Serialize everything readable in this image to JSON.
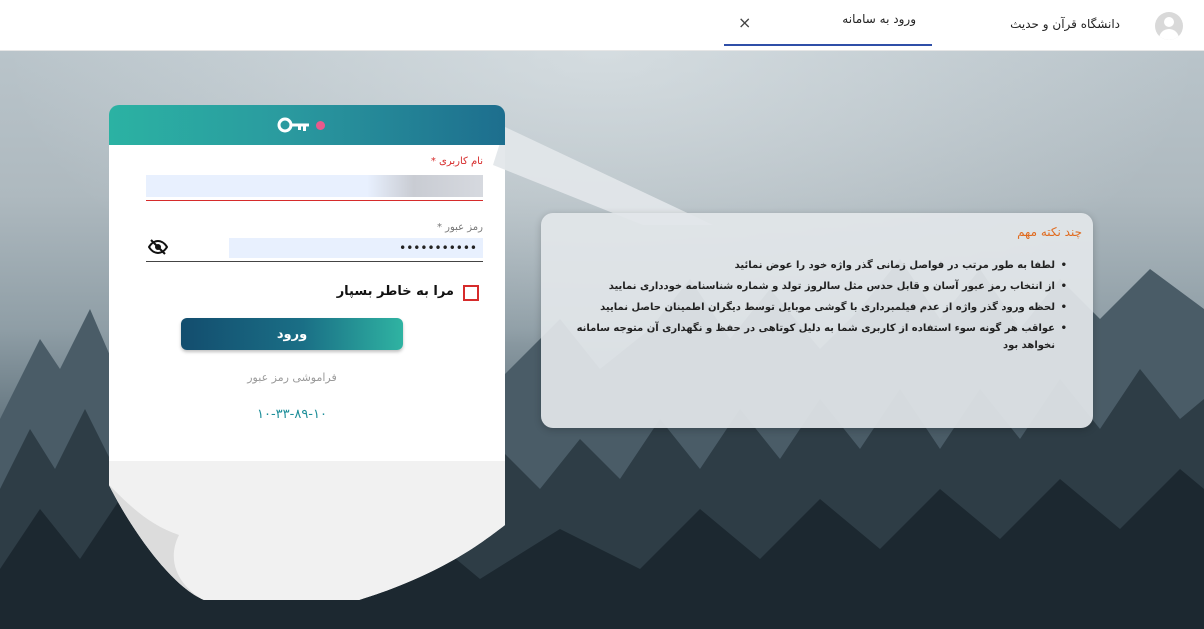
{
  "header": {
    "university_name": "دانشگاه قرآن و حدیث",
    "tab_label": "ورود به سامانه",
    "tab_close": "×"
  },
  "login": {
    "username_label": "نام کاربری *",
    "username_value": "",
    "password_label": "رمز عبور *",
    "password_value": "•••••••••••",
    "remember_label": "مرا به خاطر بسپار",
    "login_button": "ورود",
    "forgot_link": "فراموشی رمز عبور",
    "code": "۱۰-۳۳-۸۹-۱۰"
  },
  "info": {
    "title": "چند نکته مهم",
    "items": [
      "لطفا به طور مرتب در فواصل زمانی گذر واژه خود را عوض نمائید",
      "از انتخاب رمز عبور آسان و قابل حدس مثل سالروز تولد و شماره شناسنامه خودداری نمایید",
      "لحظه ورود گذر واژه از عدم فیلمبرداری با گوشی موبایل توسط دیگران اطمینان حاصل نمایید",
      "عواقب هر گونه سوء استفاده از کاربری شما به دلیل کوتاهی در حفظ و نگهداری آن متوجه سامانه نخواهد بود"
    ]
  },
  "colors": {
    "accent": "#2f4fa8",
    "header_gradient_start": "#2bb2a3",
    "header_gradient_end": "#1d6e8e",
    "required": "#d62b2b",
    "info_title": "#e06b1f",
    "code": "#1f8f9a"
  },
  "icons": {
    "avatar": "user-avatar-icon",
    "key": "key-icon",
    "eye": "eye-slash-icon",
    "close": "close-icon"
  }
}
